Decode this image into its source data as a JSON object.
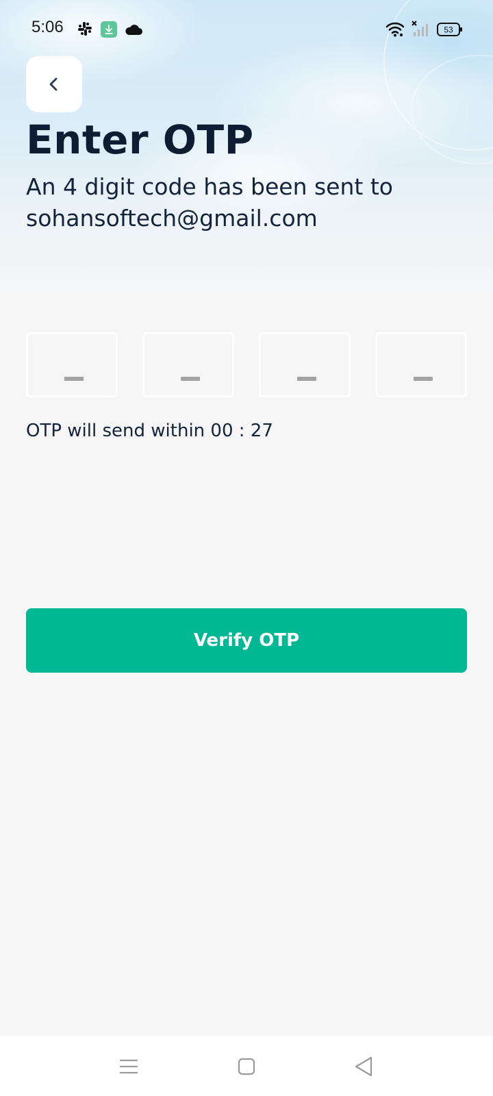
{
  "status_bar": {
    "time": "5:06",
    "battery": "53",
    "icons": [
      "slack-icon",
      "download-icon",
      "cloud-icon",
      "wifi-icon",
      "signal-icon",
      "battery-icon"
    ]
  },
  "header": {
    "back_icon": "chevron-left-icon",
    "title": "Enter OTP",
    "subtitle": "An 4 digit code has been sent to sohansoftech@gmail.com"
  },
  "otp": {
    "digits": [
      "",
      "",
      "",
      ""
    ],
    "placeholder": "–",
    "timer_text": "OTP will send within 00 : 27"
  },
  "actions": {
    "verify_label": "Verify OTP"
  },
  "nav": {
    "icons": [
      "menu-icon",
      "home-square-icon",
      "back-triangle-icon"
    ]
  },
  "colors": {
    "accent": "#00b893",
    "title": "#0f1d33",
    "background": "#f6f6f7"
  }
}
